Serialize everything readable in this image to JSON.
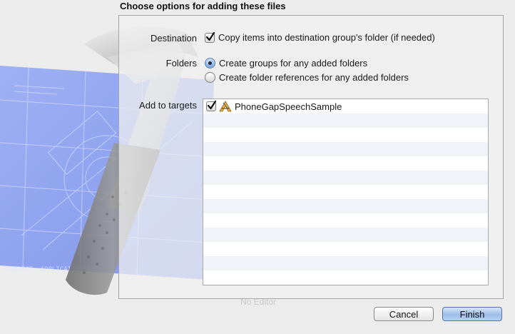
{
  "dialog": {
    "title": "Choose options for adding these files",
    "background_ghost_text": "No Editor"
  },
  "destination": {
    "label": "Destination",
    "copy_items": {
      "checked": true,
      "label": "Copy items into destination group's folder (if needed)"
    }
  },
  "folders": {
    "label": "Folders",
    "options": [
      {
        "label": "Create groups for any added folders",
        "selected": true
      },
      {
        "label": "Create folder references for any added folders",
        "selected": false
      }
    ]
  },
  "targets": {
    "label": "Add to targets",
    "items": [
      {
        "name": "PhoneGapSpeechSample",
        "checked": true,
        "icon": "app-target-icon"
      }
    ]
  },
  "buttons": {
    "cancel": "Cancel",
    "finish": "Finish"
  },
  "colors": {
    "default_button": "#9dbde8",
    "selection_accent": "#5a7fb4",
    "blueprint": "#8fa4f0"
  }
}
